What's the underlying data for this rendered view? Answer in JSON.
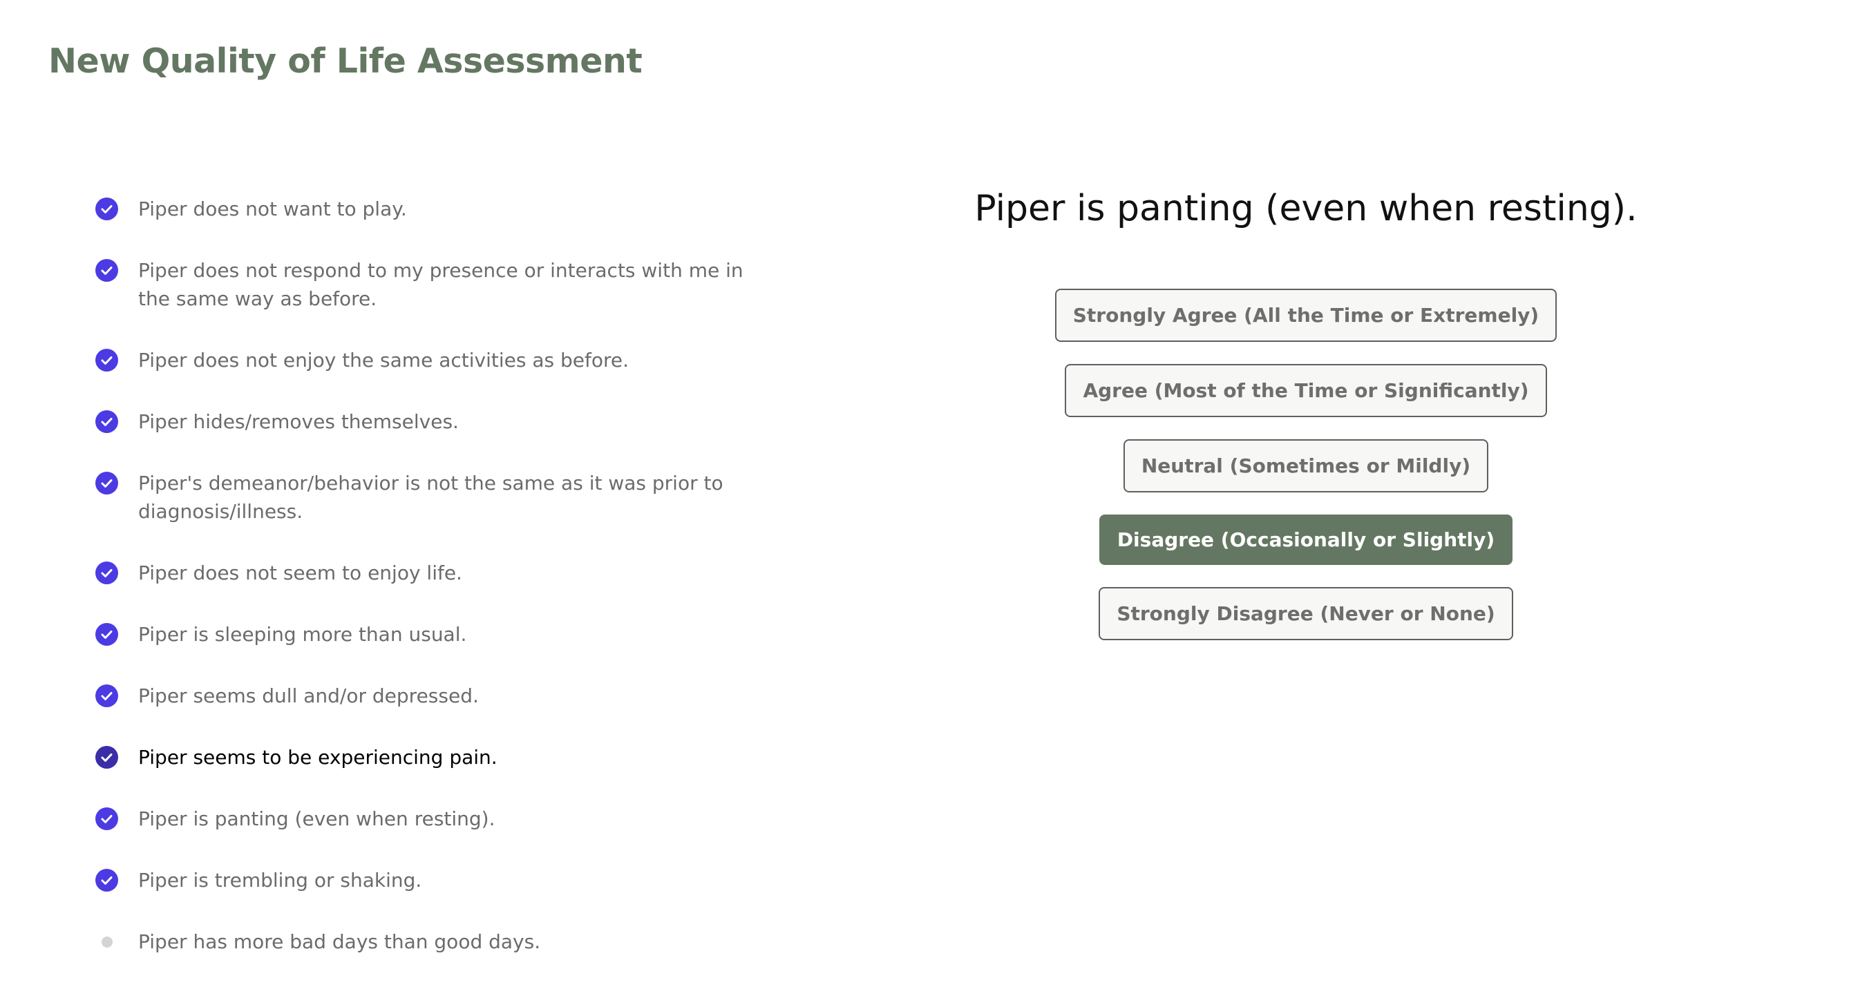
{
  "page": {
    "title": "New Quality of Life Assessment"
  },
  "colors": {
    "brand": "#647762",
    "check": "#4c3ae3",
    "check_active": "#3a2da7",
    "pending": "#d4d4d4"
  },
  "questions": [
    {
      "text": "Piper does not want to play.",
      "status": "answered",
      "icon": "check-circle-icon"
    },
    {
      "text": "Piper does not respond to my presence or interacts with me in the same way as before.",
      "status": "answered",
      "icon": "check-circle-icon"
    },
    {
      "text": "Piper does not enjoy the same activities as before.",
      "status": "answered",
      "icon": "check-circle-icon"
    },
    {
      "text": "Piper hides/removes themselves.",
      "status": "answered",
      "icon": "check-circle-icon"
    },
    {
      "text": "Piper's demeanor/behavior is not the same as it was prior to diagnosis/illness.",
      "status": "answered",
      "icon": "check-circle-icon"
    },
    {
      "text": "Piper does not seem to enjoy life.",
      "status": "answered",
      "icon": "check-circle-icon"
    },
    {
      "text": "Piper is sleeping more than usual.",
      "status": "answered",
      "icon": "check-circle-icon"
    },
    {
      "text": "Piper seems dull and/or depressed.",
      "status": "answered",
      "icon": "check-circle-icon"
    },
    {
      "text": "Piper seems to be experiencing pain.",
      "status": "answered-active",
      "icon": "check-circle-icon"
    },
    {
      "text": "Piper is panting (even when resting).",
      "status": "answered",
      "icon": "check-circle-icon"
    },
    {
      "text": "Piper is trembling or shaking.",
      "status": "answered",
      "icon": "check-circle-icon"
    },
    {
      "text": "Piper has more bad days than good days.",
      "status": "pending",
      "icon": "pending-dot-icon"
    }
  ],
  "current_question": {
    "text": "Piper is panting (even when resting)."
  },
  "answers": [
    {
      "label": "Strongly Agree (All the Time or Extremely)",
      "selected": false
    },
    {
      "label": "Agree (Most of the Time or Significantly)",
      "selected": false
    },
    {
      "label": "Neutral (Sometimes or Mildly)",
      "selected": false
    },
    {
      "label": "Disagree (Occasionally or Slightly)",
      "selected": true
    },
    {
      "label": "Strongly Disagree (Never or None)",
      "selected": false
    }
  ]
}
